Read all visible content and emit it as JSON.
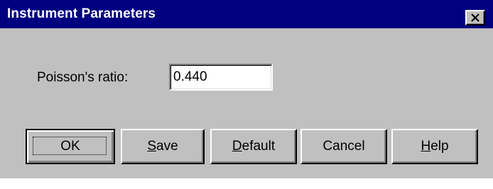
{
  "window": {
    "title": "Instrument Parameters"
  },
  "field": {
    "label": "Poisson's ratio:",
    "value": "0.440"
  },
  "buttons": {
    "ok": "OK",
    "save_mnemonic": "S",
    "save_rest": "ave",
    "default_mnemonic": "D",
    "default_rest": "efault",
    "cancel": "Cancel",
    "help_mnemonic": "H",
    "help_rest": "elp"
  },
  "icons": {
    "close": "close-icon"
  },
  "colors": {
    "title_bar": "#000080",
    "window_bg": "#c0c0c0"
  }
}
